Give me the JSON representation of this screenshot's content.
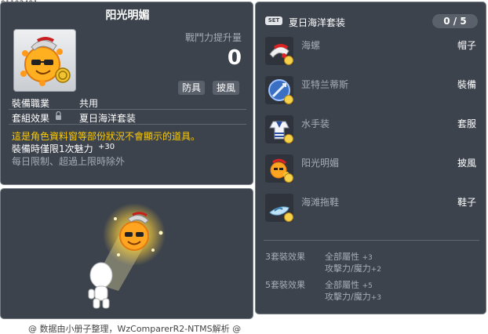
{
  "item_id": "01102491",
  "item": {
    "name": "阳光明媚",
    "power_label": "戰鬥力提升量",
    "power_value": "0",
    "tags": [
      "防具",
      "披風"
    ],
    "job_label": "裝備職業",
    "job_value": "共用",
    "set_effect_label": "套組效果",
    "set_effect_value": "夏日海洋套装",
    "warning": "這是角色資料窗等部份狀況不會顯示的道具。",
    "charm_label": "裝備時僅限1次魅力",
    "charm_value": "+30",
    "limit_note": "每日限制、超過上限時除外"
  },
  "credit": "@ 数据由小册子整理，WzComparerR2-NTMS解析 @",
  "set": {
    "badge": "SET",
    "name": "夏日海洋套装",
    "count": "0 / 5",
    "items": [
      {
        "name": "海螺",
        "type": "帽子",
        "icon": "shell-hat-icon"
      },
      {
        "name": "亚特兰蒂斯",
        "type": "裝備",
        "icon": "atlantis-weapon-icon"
      },
      {
        "name": "水手装",
        "type": "套服",
        "icon": "sailor-suit-icon"
      },
      {
        "name": "阳光明媚",
        "type": "披風",
        "icon": "sunshine-cape-icon"
      },
      {
        "name": "海滩拖鞋",
        "type": "鞋子",
        "icon": "beach-slippers-icon"
      }
    ],
    "effects": [
      {
        "label": "3套裝效果",
        "stats": [
          {
            "name": "全部屬性",
            "value": "+3"
          },
          {
            "name": "攻擊力/魔力",
            "value": "+2"
          }
        ]
      },
      {
        "label": "5套裝效果",
        "stats": [
          {
            "name": "全部屬性",
            "value": "+5"
          },
          {
            "name": "攻擊力/魔力",
            "value": "+3"
          }
        ]
      }
    ]
  },
  "colors": {
    "panel": "#3d434d",
    "border": "#767d86",
    "muted": "#a6acb4",
    "warning": "#ffcc00"
  }
}
